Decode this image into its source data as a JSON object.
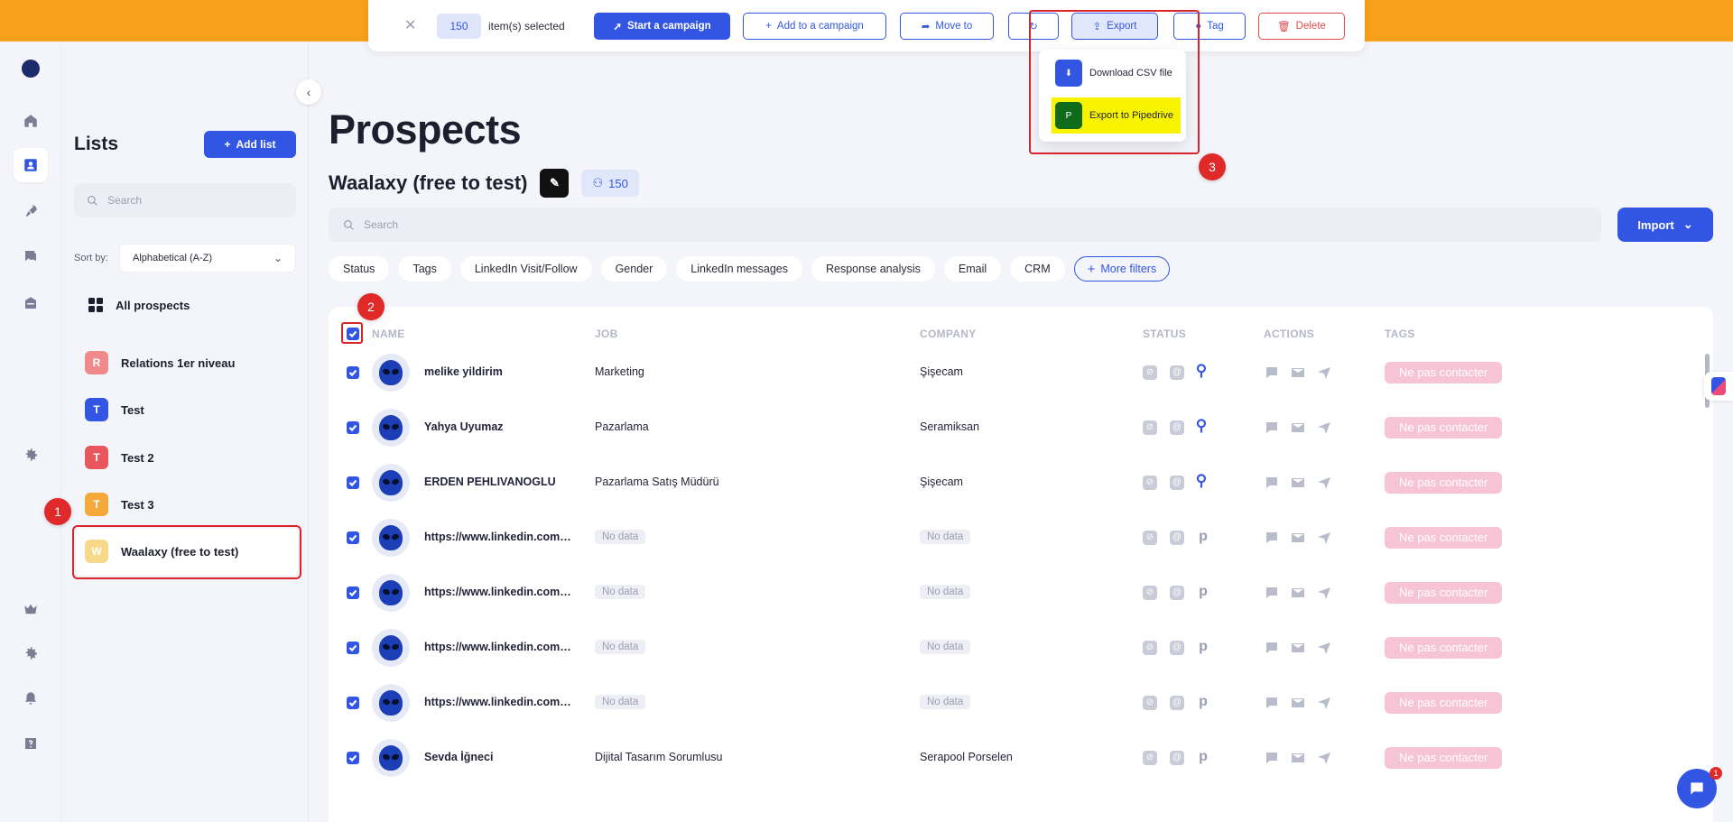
{
  "colors": {
    "accent": "#3256e3",
    "banner": "#f9a01b",
    "annotation": "#d9242c",
    "tag_bg": "#f7c4d6"
  },
  "action_bar": {
    "close_icon": "close-icon",
    "selected_count": "150",
    "selected_label": "item(s) selected",
    "buttons": {
      "start_campaign": "Start a campaign",
      "add_to_campaign": "Add to a campaign",
      "move_to": "Move to",
      "refresh": "",
      "export": "Export",
      "tag": "Tag",
      "delete": "Delete"
    }
  },
  "export_menu": {
    "items": [
      {
        "label": "Download CSV file",
        "icon": "download-icon"
      },
      {
        "label": "Export to Pipedrive",
        "icon": "pipedrive-icon",
        "icon_text": "P"
      }
    ]
  },
  "sidebar": {
    "title": "Lists",
    "add_list_label": "Add list",
    "search_placeholder": "Search",
    "sort_label": "Sort by:",
    "sort_value": "Alphabetical (A-Z)",
    "all_prospects_label": "All prospects",
    "lists": [
      {
        "initial": "R",
        "label": "Relations 1er niveau",
        "color": "#f08a8a"
      },
      {
        "initial": "T",
        "label": "Test",
        "color": "#3256e3"
      },
      {
        "initial": "T",
        "label": "Test 2",
        "color": "#e8575b"
      },
      {
        "initial": "T",
        "label": "Test 3",
        "color": "#f5a93b"
      },
      {
        "initial": "W",
        "label": "Waalaxy (free to test)",
        "color": "#f8d98a"
      }
    ]
  },
  "markers": {
    "m1": "1",
    "m2": "2",
    "m3": "3"
  },
  "main": {
    "title": "Prospects",
    "list_name": "Waalaxy (free to test)",
    "prospect_count": "150",
    "search_placeholder": "Search",
    "import_label": "Import",
    "filters": [
      "Status",
      "Tags",
      "LinkedIn Visit/Follow",
      "Gender",
      "LinkedIn messages",
      "Response analysis",
      "Email",
      "CRM"
    ],
    "more_filters_label": "More filters",
    "columns": {
      "name": "NAME",
      "job": "JOB",
      "company": "COMPANY",
      "status": "STATUS",
      "actions": "ACTIONS",
      "tags": "TAGS"
    },
    "rows": [
      {
        "name": "melike yildirim",
        "job": "Marketing",
        "company": "Şişecam",
        "crm": "hubspot",
        "tag": "Ne pas contacter"
      },
      {
        "name": "Yahya Uyumaz",
        "job": "Pazarlama",
        "company": "Seramiksan",
        "crm": "hubspot",
        "tag": "Ne pas contacter"
      },
      {
        "name": "ERDEN PEHLIVANOGLU",
        "job": "Pazarlama Satış Müdürü",
        "company": "Şişecam",
        "crm": "hubspot",
        "tag": "Ne pas contacter"
      },
      {
        "name": "https://www.linkedin.com/in/",
        "job": "No data",
        "company": "No data",
        "crm": "pipedrive",
        "tag": "Ne pas contacter"
      },
      {
        "name": "https://www.linkedin.com/in/",
        "job": "No data",
        "company": "No data",
        "crm": "pipedrive",
        "tag": "Ne pas contacter"
      },
      {
        "name": "https://www.linkedin.com/in/",
        "job": "No data",
        "company": "No data",
        "crm": "pipedrive",
        "tag": "Ne pas contacter"
      },
      {
        "name": "https://www.linkedin.com/in/",
        "job": "No data",
        "company": "No data",
        "crm": "pipedrive",
        "tag": "Ne pas contacter"
      },
      {
        "name": "Sevda İğneci",
        "job": "Dijital Tasarım Sorumlusu",
        "company": "Serapool Porselen",
        "crm": "pipedrive",
        "tag": "Ne pas contacter"
      }
    ]
  },
  "chat": {
    "badge": "1"
  }
}
